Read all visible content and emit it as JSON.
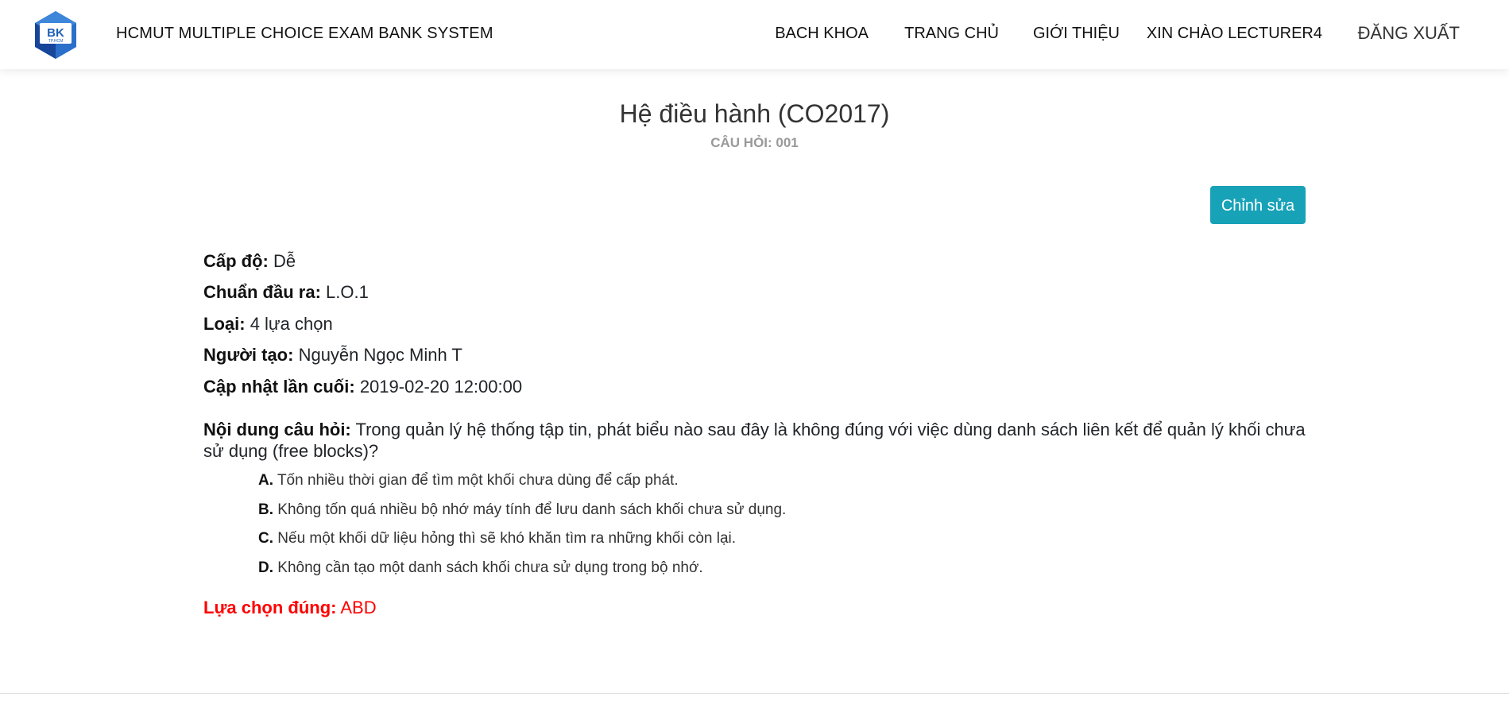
{
  "header": {
    "logo_text": "BK",
    "logo_subtext": "TP.HCM",
    "app_title": "HCMUT MULTIPLE CHOICE EXAM BANK SYSTEM",
    "nav": {
      "bach_khoa": "BACH KHOA",
      "home": "TRANG CHỦ",
      "about": "GIỚI THIỆU",
      "greeting": "XIN CHÀO LECTURER4",
      "logout": "ĐĂNG XUẤT"
    }
  },
  "course": {
    "title": "Hệ điều hành (CO2017)",
    "question_code": "CÂU HỎI: 001"
  },
  "actions": {
    "edit_label": "Chỉnh sửa"
  },
  "details": {
    "level_label": "Cấp độ:",
    "level_value": "Dễ",
    "outcome_label": "Chuẩn đầu ra:",
    "outcome_value": "L.O.1",
    "type_label": "Loại:",
    "type_value": "4 lựa chọn",
    "creator_label": "Người tạo:",
    "creator_value": "Nguyễn Ngọc Minh T",
    "updated_label": "Cập nhật lần cuối:",
    "updated_value": "2019-02-20 12:00:00"
  },
  "question": {
    "label": "Nội dung câu hỏi:",
    "text": "Trong quản lý hệ thống tập tin, phát biểu nào sau đây là không đúng với việc dùng danh sách liên kết để quản lý khối chưa sử dụng (free blocks)?",
    "options": [
      {
        "letter": "A.",
        "text": "Tốn nhiều thời gian để tìm một khối chưa dùng để cấp phát."
      },
      {
        "letter": "B.",
        "text": "Không tốn quá nhiều bộ nhớ máy tính để lưu danh sách khối chưa sử dụng."
      },
      {
        "letter": "C.",
        "text": "Nếu một khối dữ liệu hỏng thì sẽ khó khăn tìm ra những khối còn lại."
      },
      {
        "letter": "D.",
        "text": "Không cần tạo một danh sách khối chưa sử dụng trong bộ nhớ."
      }
    ]
  },
  "answer": {
    "label": "Lựa chọn đúng:",
    "value": "ABD"
  },
  "colors": {
    "accent": "#17a2b8",
    "logo_blue": "#1f5fb8",
    "correct_answer": "#ff0000"
  }
}
